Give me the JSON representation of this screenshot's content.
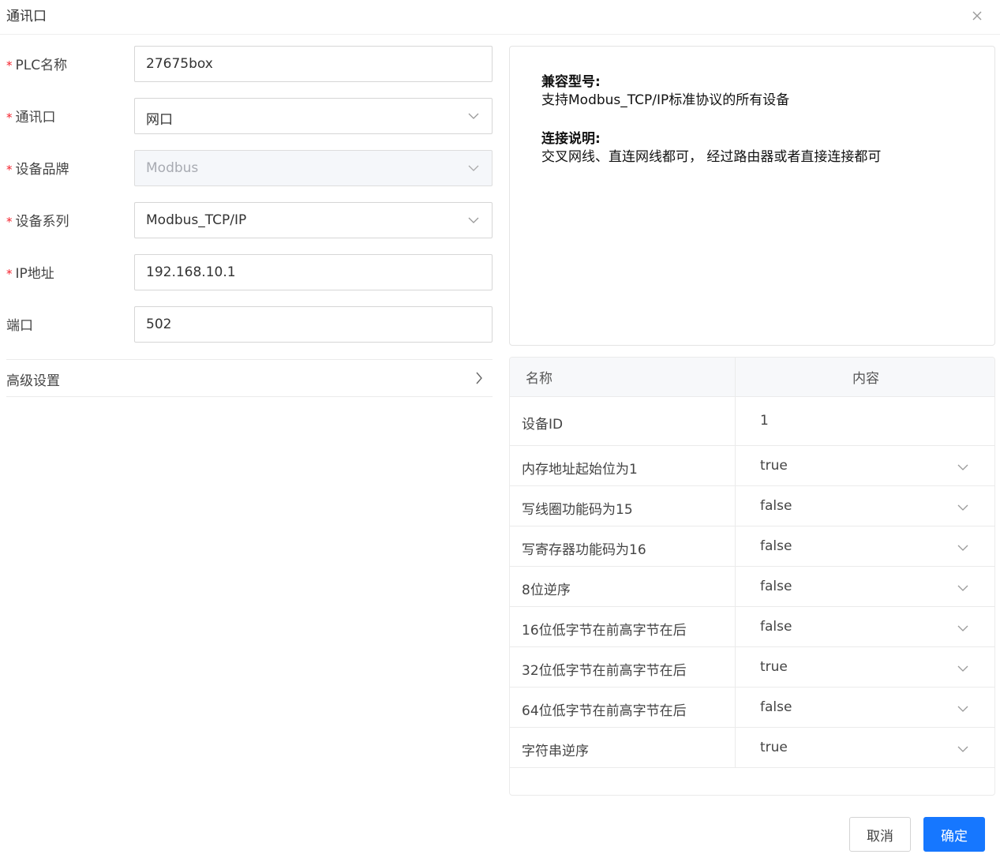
{
  "dialog": {
    "title": "通讯口"
  },
  "form": {
    "plc_name": {
      "label": "PLC名称",
      "required": true,
      "value": "27675box"
    },
    "comm_port": {
      "label": "通讯口",
      "required": true,
      "value": "网口"
    },
    "brand": {
      "label": "设备品牌",
      "required": true,
      "value": "Modbus",
      "disabled": true
    },
    "series": {
      "label": "设备系列",
      "required": true,
      "value": "Modbus_TCP/IP"
    },
    "ip": {
      "label": "IP地址",
      "required": true,
      "value": "192.168.10.1"
    },
    "port": {
      "label": "端口",
      "required": false,
      "value": "502"
    },
    "required_mark": "*"
  },
  "advanced": {
    "label": "高级设置"
  },
  "info": {
    "compat_heading": "兼容型号:",
    "compat_text": "支持Modbus_TCP/IP标准协议的所有设备",
    "conn_heading": "连接说明:",
    "conn_text": "交叉网线、直连网线都可， 经过路由器或者直接连接都可"
  },
  "table": {
    "headers": {
      "name": "名称",
      "content": "内容"
    },
    "rows": [
      {
        "name": "设备ID",
        "value": "1",
        "dropdown": false
      },
      {
        "name": "内存地址起始位为1",
        "value": "true",
        "dropdown": true
      },
      {
        "name": "写线圈功能码为15",
        "value": "false",
        "dropdown": true
      },
      {
        "name": "写寄存器功能码为16",
        "value": "false",
        "dropdown": true
      },
      {
        "name": "8位逆序",
        "value": "false",
        "dropdown": true
      },
      {
        "name": "16位低字节在前高字节在后",
        "value": "false",
        "dropdown": true
      },
      {
        "name": "32位低字节在前高字节在后",
        "value": "true",
        "dropdown": true
      },
      {
        "name": "64位低字节在前高字节在后",
        "value": "false",
        "dropdown": true
      },
      {
        "name": "字符串逆序",
        "value": "true",
        "dropdown": true
      }
    ]
  },
  "buttons": {
    "cancel": "取消",
    "ok": "确定"
  },
  "colors": {
    "primary": "#1677ff",
    "required": "#f5222d"
  }
}
